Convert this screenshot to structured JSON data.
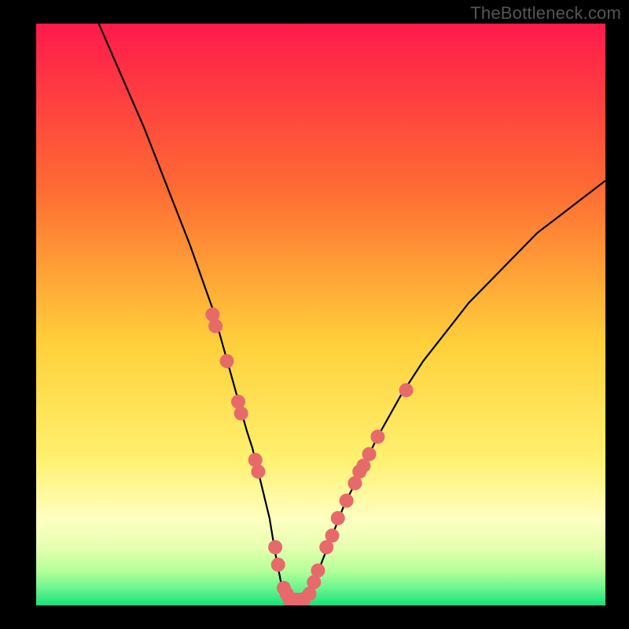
{
  "watermark": "TheBottleneck.com",
  "colors": {
    "frame_bg": "#000000",
    "grad_top": "#ff1a4b",
    "grad_mid1": "#ff7a2a",
    "grad_mid2": "#ffd83a",
    "grad_mid3": "#fff99a",
    "grad_low1": "#d8ff8c",
    "grad_low2": "#9effa6",
    "grad_bottom": "#18e07a",
    "curve": "#000000",
    "marker_fill": "#e76a6a",
    "marker_stroke": "#c24b4b"
  },
  "chart_data": {
    "type": "line",
    "title": "",
    "xlabel": "",
    "ylabel": "",
    "xlim": [
      0,
      100
    ],
    "ylim": [
      0,
      100
    ],
    "x": [
      11,
      15,
      19,
      23,
      27,
      31,
      33,
      35,
      37,
      38,
      39,
      40,
      41,
      42,
      43,
      44,
      45,
      46,
      48,
      50,
      52,
      54,
      57,
      60,
      64,
      68,
      72,
      76,
      80,
      84,
      88,
      92,
      96,
      100
    ],
    "values": [
      100,
      91,
      82,
      72,
      62,
      51,
      44,
      37,
      30,
      27,
      23,
      19,
      15,
      9,
      4,
      2,
      1,
      1,
      3,
      7,
      12,
      17,
      23,
      29,
      36,
      42,
      47,
      52,
      56,
      60,
      64,
      67,
      70,
      73
    ],
    "markers": [
      {
        "x": 31.0,
        "y": 50
      },
      {
        "x": 31.5,
        "y": 48
      },
      {
        "x": 33.5,
        "y": 42
      },
      {
        "x": 35.5,
        "y": 35
      },
      {
        "x": 36.0,
        "y": 33
      },
      {
        "x": 38.5,
        "y": 25
      },
      {
        "x": 39.0,
        "y": 23
      },
      {
        "x": 42.0,
        "y": 10
      },
      {
        "x": 42.5,
        "y": 7
      },
      {
        "x": 43.5,
        "y": 3
      },
      {
        "x": 44.0,
        "y": 2
      },
      {
        "x": 44.5,
        "y": 1
      },
      {
        "x": 45.5,
        "y": 1
      },
      {
        "x": 46.5,
        "y": 1
      },
      {
        "x": 47.0,
        "y": 1
      },
      {
        "x": 48.0,
        "y": 2
      },
      {
        "x": 48.8,
        "y": 4
      },
      {
        "x": 49.5,
        "y": 6
      },
      {
        "x": 51.0,
        "y": 10
      },
      {
        "x": 52.0,
        "y": 12
      },
      {
        "x": 53.0,
        "y": 15
      },
      {
        "x": 54.5,
        "y": 18
      },
      {
        "x": 56.0,
        "y": 21
      },
      {
        "x": 56.8,
        "y": 23
      },
      {
        "x": 57.5,
        "y": 24
      },
      {
        "x": 58.5,
        "y": 26
      },
      {
        "x": 60.0,
        "y": 29
      },
      {
        "x": 65.0,
        "y": 37
      }
    ]
  }
}
